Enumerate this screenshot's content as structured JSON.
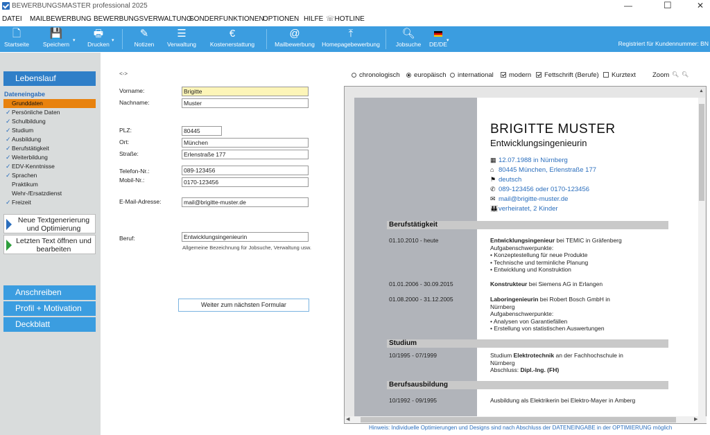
{
  "window": {
    "title": "BEWERBUNGSMASTER professional 2025"
  },
  "menu": [
    "DATEI",
    "MAILBEWERBUNG",
    "BEWERBUNGSVERWALTUNG",
    "SONDERFUNKTIONEN",
    "OPTIONEN",
    "HILFE",
    "HOTLINE"
  ],
  "toolbar": {
    "items": [
      "Startseite",
      "Speichern",
      "Drucken",
      "Notizen",
      "Verwaltung",
      "Kostenerstattung",
      "Mailbewerbung",
      "Homepagebewerbung",
      "Jobsuche",
      "DE/DE"
    ],
    "registered": "Registriert für Kundennummer: BN"
  },
  "sidebar": {
    "top_button": "Lebenslauf",
    "section_title": "Dateneingabe",
    "items": [
      {
        "label": "Grunddaten",
        "checked": false,
        "selected": true
      },
      {
        "label": "Persönliche Daten",
        "checked": true
      },
      {
        "label": "Schulbildung",
        "checked": true
      },
      {
        "label": "Studium",
        "checked": true
      },
      {
        "label": "Ausbildung",
        "checked": true
      },
      {
        "label": "Berufstätigkeit",
        "checked": true
      },
      {
        "label": "Weiterbildung",
        "checked": true
      },
      {
        "label": "EDV-Kenntnisse",
        "checked": true
      },
      {
        "label": "Sprachen",
        "checked": true
      },
      {
        "label": "Praktikum",
        "checked": false
      },
      {
        "label": "Wehr-/Ersatzdienst",
        "checked": false
      },
      {
        "label": "Freizeit",
        "checked": true
      }
    ],
    "action1": "Neue Textgenerierung und Optimierung",
    "action2": "Letzten Text öffnen und bearbeiten",
    "bottom_buttons": [
      "Anschreiben",
      "Profil + Motivation",
      "Deckblatt"
    ]
  },
  "form": {
    "toggle": "<->",
    "fields": {
      "vorname": {
        "label": "Vorname:",
        "value": "Brigitte"
      },
      "nachname": {
        "label": "Nachname:",
        "value": "Muster"
      },
      "plz": {
        "label": "PLZ:",
        "value": "80445"
      },
      "ort": {
        "label": "Ort:",
        "value": "München"
      },
      "strasse": {
        "label": "Straße:",
        "value": "Erlenstraße 177"
      },
      "telefon": {
        "label": "Telefon-Nr.:",
        "value": "089-123456"
      },
      "mobil": {
        "label": "Mobil-Nr.:",
        "value": "0170-123456"
      },
      "email": {
        "label": "E-Mail-Adresse:",
        "value": "mail@brigitte-muster.de"
      },
      "beruf": {
        "label": "Beruf:",
        "value": "Entwicklungsingenieurin"
      }
    },
    "beruf_hint": "Allgemeine Bezeichnung für Jobsuche, Verwaltung usw.",
    "next_button": "Weiter zum nächsten Formular"
  },
  "options": {
    "layout": [
      {
        "label": "chronologisch",
        "selected": false
      },
      {
        "label": "europäisch",
        "selected": true
      },
      {
        "label": "international",
        "selected": false
      }
    ],
    "checks": [
      {
        "label": "modern",
        "checked": true
      },
      {
        "label": "Fettschrift (Berufe)",
        "checked": true
      },
      {
        "label": "Kurztext",
        "checked": false
      }
    ],
    "zoom_label": "Zoom"
  },
  "preview": {
    "name": "BRIGITTE MUSTER",
    "job": "Entwicklungsingenieurin",
    "contacts": [
      {
        "icon": "calendar-icon",
        "text": "12.07.1988 in Nürnberg"
      },
      {
        "icon": "home-icon",
        "text": "80445 München, Erlenstraße 177"
      },
      {
        "icon": "flag-icon",
        "text": "deutsch"
      },
      {
        "icon": "phone-icon",
        "text": "089-123456 oder 0170-123456"
      },
      {
        "icon": "mail-icon",
        "text": "mail@brigitte-muster.de"
      },
      {
        "icon": "family-icon",
        "text": "verheiratet, 2 Kinder"
      }
    ],
    "sections": {
      "beruf": "Berufstätigkeit",
      "studium": "Studium",
      "ausbildung": "Berufsausbildung"
    },
    "jobs": [
      {
        "date": "01.10.2010 - heute",
        "title": "Entwicklungsingenieur",
        "rest": " bei TEMIC in Gräfenberg",
        "sub": "Aufgabenschwerpunkte:",
        "bullets": [
          "• Konzeptestellung für neue Produkte",
          "• Technische und terminliche Planung",
          "• Entwicklung und Konstruktion"
        ]
      },
      {
        "date": "01.01.2006 - 30.09.2015",
        "title": "Konstrukteur",
        "rest": " bei Siemens AG in Erlangen"
      },
      {
        "date": "01.08.2000 - 31.12.2005",
        "title": "Laboringenieurin",
        "rest": " bei Robert Bosch GmbH in Nürnberg",
        "sub": "Aufgabenschwerpunkte:",
        "bullets": [
          "• Analysen von Garantiefällen",
          "• Erstellung von statistischen Auswertungen"
        ]
      }
    ],
    "study": {
      "date": "10/1995 - 07/1999",
      "pre": "Studium ",
      "bold": "Elektrotechnik",
      "post": " an der Fachhochschule in Nürnberg",
      "degree_label": "Abschluss: ",
      "degree": "Dipl.-Ing. (FH)"
    },
    "training": {
      "date": "10/1992 - 09/1995",
      "text": "Ausbildung als Elektrikerin bei Elektro-Mayer in Amberg"
    }
  },
  "hint": "Hinweis: Individuelle Optimierungen und Designs sind nach Abschluss der DATENEINGABE in der OPTIMIERUNG möglich"
}
